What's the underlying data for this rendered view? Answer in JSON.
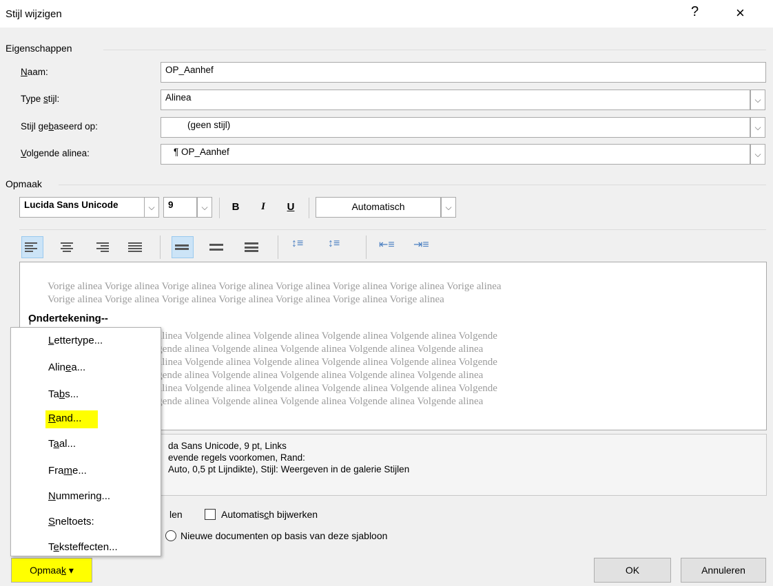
{
  "window": {
    "title": "Stijl wijzigen",
    "help": "?",
    "close": "×"
  },
  "properties": {
    "section_label": "Eigenschappen",
    "name_label": "Naam:",
    "name_value": "OP_Aanhef",
    "type_label": "Type stijl:",
    "type_value": "Alinea",
    "based_label": "Stijl gebaseerd op:",
    "based_value": "(geen stijl)",
    "next_label": "Volgende alinea:",
    "next_value": "¶ OP_Aanhef"
  },
  "format": {
    "section_label": "Opmaak",
    "font": "Lucida Sans Unicode",
    "size": "9",
    "bold": "B",
    "italic": "I",
    "underline": "U",
    "color": "Automatisch"
  },
  "preview": {
    "prev_line1": "Vorige alinea Vorige alinea Vorige alinea Vorige alinea Vorige alinea Vorige alinea Vorige alinea Vorige alinea",
    "prev_line2": "Vorige alinea Vorige alinea Vorige alinea Vorige alinea Vorige alinea Vorige alinea Vorige alinea",
    "sample": "Ondertekening--",
    "next_lines": [
      "Volgende alinea Volgende alinea Volgende alinea Volgende alinea Volgende alinea Volgende alinea Volgende",
      "alinea Volgende alinea Volgende alinea Volgende alinea Volgende alinea Volgende alinea Volgende alinea",
      "Volgende alinea Volgende alinea Volgende alinea Volgende alinea Volgende alinea Volgende alinea Volgende",
      "alinea Volgende alinea Volgende alinea Volgende alinea Volgende alinea Volgende alinea Volgende alinea",
      "Volgende alinea Volgende alinea Volgende alinea Volgende alinea Volgende alinea Volgende alinea Volgende",
      "alinea Volgende alinea Volgende alinea Volgende alinea Volgende alinea Volgende alinea Volgende alinea"
    ]
  },
  "description": {
    "line1": "da Sans Unicode, 9 pt, Links",
    "line2": "evende regels voorkomen, Rand:",
    "line3": "Auto,  0,5 pt Lijndikte), Stijl: Weergeven in de galerie Stijlen"
  },
  "options": {
    "gallery_label_tail": "len",
    "auto_update_label": "Automatisch bijwerken",
    "new_docs_label": "Nieuwe documenten op basis van deze sjabloon"
  },
  "menu": {
    "items": [
      "Lettertype...",
      "Alinea...",
      "Tabs...",
      "Rand...",
      "Taal...",
      "Frame...",
      "Nummering...",
      "Sneltoets:",
      "Teksteffecten..."
    ],
    "highlighted": "Rand..."
  },
  "buttons": {
    "format": "Opmaak ▾",
    "ok": "OK",
    "cancel": "Annuleren"
  },
  "colors": {
    "highlight": "#ffff00",
    "active_toggle": "#cce4f7"
  }
}
